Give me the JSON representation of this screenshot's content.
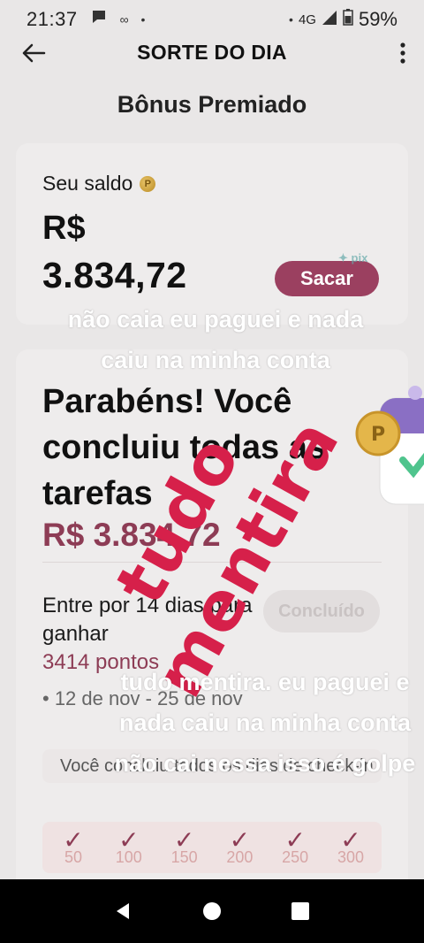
{
  "status_bar": {
    "time": "21:37",
    "network": "4G",
    "battery": "59%"
  },
  "app_bar": {
    "title": "SORTE DO DIA"
  },
  "page": {
    "heading": "Bônus Premiado"
  },
  "balance": {
    "label": "Seu saldo",
    "currency": "R$",
    "amount": "3.834,72",
    "withdraw_label": "Sacar",
    "pix_label": "pix"
  },
  "tasks": {
    "congrats": "Parabéns! Você concluiu todas as tarefas",
    "amount": "R$ 3.834,72",
    "enter_text": "Entre por 14 dias para ganhar",
    "points": "3414 pontos",
    "date_range": "• 12 de nov - 25 de nov",
    "done_label": "Concluído",
    "checkin_text": "Você concluiu todos os dias de check-in.",
    "days": [
      {
        "check": "✓",
        "value": "50"
      },
      {
        "check": "✓",
        "value": "100"
      },
      {
        "check": "✓",
        "value": "150"
      },
      {
        "check": "✓",
        "value": "200"
      },
      {
        "check": "✓",
        "value": "250"
      },
      {
        "check": "✓",
        "value": "300"
      }
    ]
  },
  "overlays": {
    "top_text": "não caia eu paguei e nada caiu na minha conta",
    "stamp_text": "tudo mentira",
    "bottom_text": "tudo mentira. eu paguei e nada caiu na minha conta não cai nessa isso é golpe"
  },
  "colors": {
    "accent": "#8d3c55",
    "stamp": "#d6204a"
  }
}
